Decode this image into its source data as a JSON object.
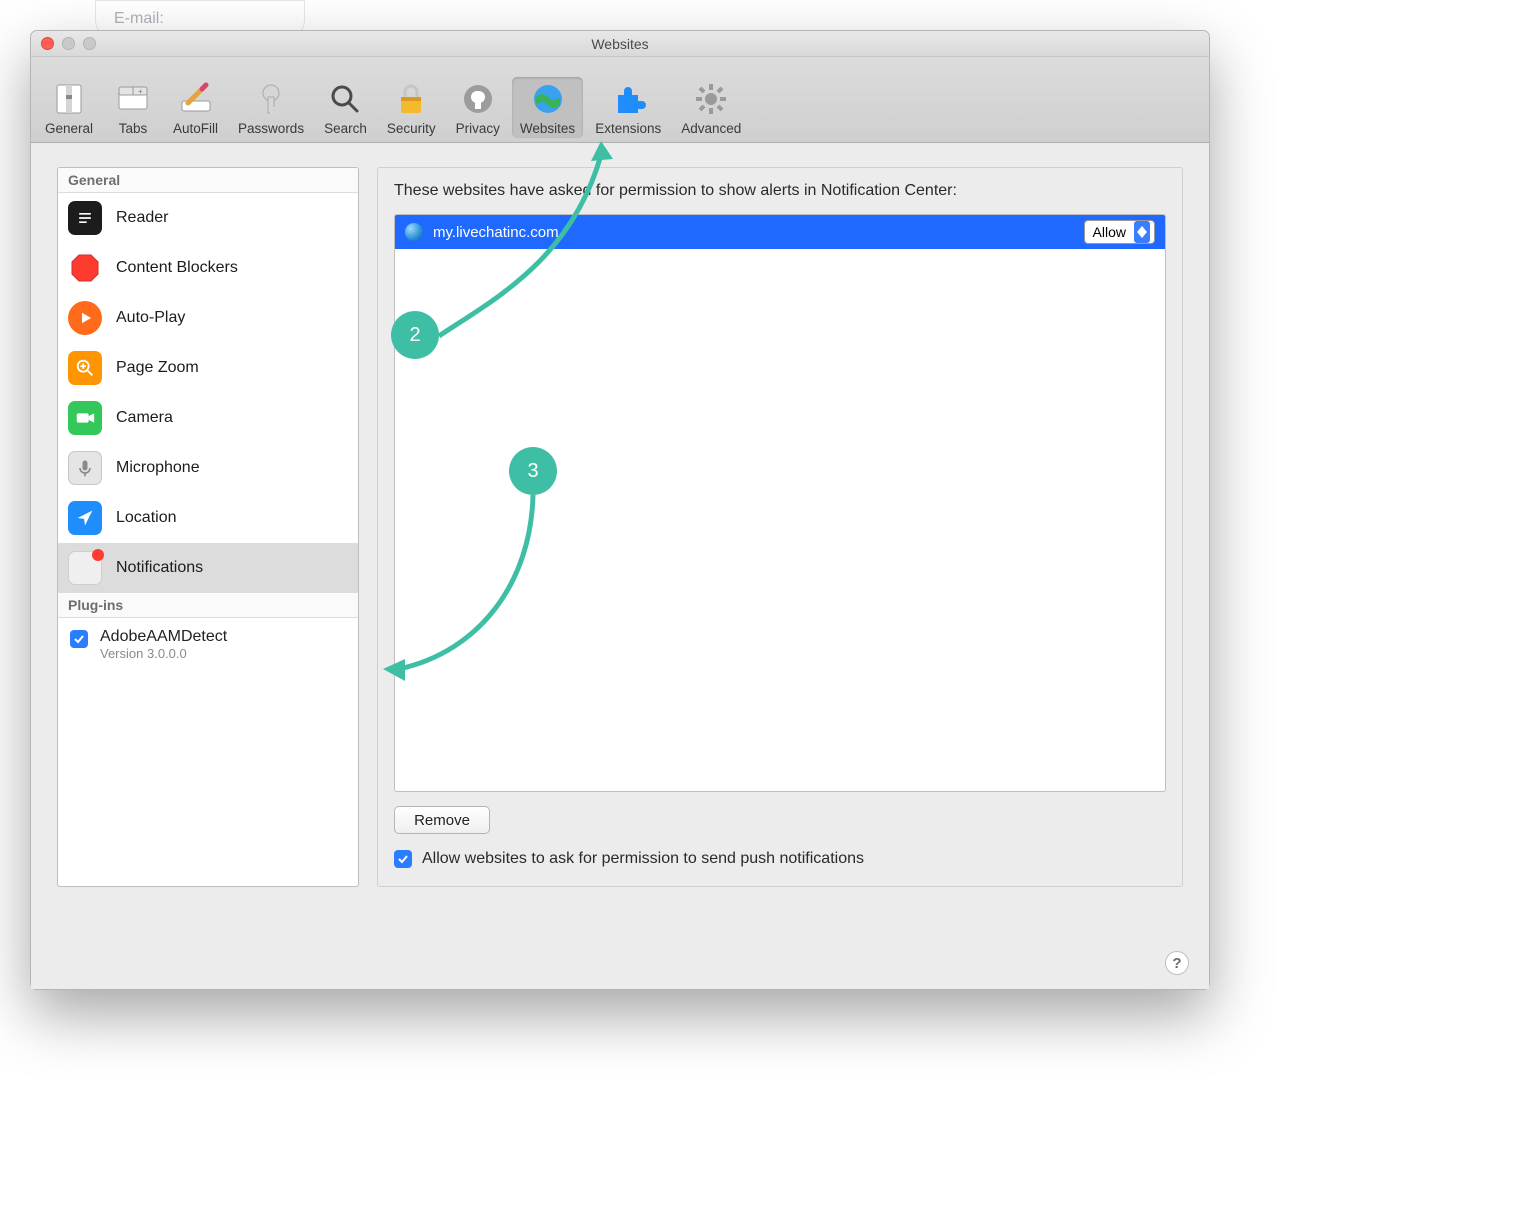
{
  "hint_bubble": "E-mail:",
  "window_title": "Websites",
  "toolbar": [
    {
      "id": "general",
      "label": "General"
    },
    {
      "id": "tabs",
      "label": "Tabs"
    },
    {
      "id": "autofill",
      "label": "AutoFill"
    },
    {
      "id": "passwords",
      "label": "Passwords"
    },
    {
      "id": "search",
      "label": "Search"
    },
    {
      "id": "security",
      "label": "Security"
    },
    {
      "id": "privacy",
      "label": "Privacy"
    },
    {
      "id": "websites",
      "label": "Websites",
      "selected": true
    },
    {
      "id": "extensions",
      "label": "Extensions"
    },
    {
      "id": "advanced",
      "label": "Advanced"
    }
  ],
  "sidebar": {
    "section1_title": "General",
    "items": [
      {
        "id": "reader",
        "label": "Reader"
      },
      {
        "id": "blockers",
        "label": "Content Blockers"
      },
      {
        "id": "autoplay",
        "label": "Auto-Play"
      },
      {
        "id": "zoom",
        "label": "Page Zoom"
      },
      {
        "id": "camera",
        "label": "Camera"
      },
      {
        "id": "microphone",
        "label": "Microphone"
      },
      {
        "id": "location",
        "label": "Location"
      },
      {
        "id": "notifications",
        "label": "Notifications",
        "selected": true
      }
    ],
    "section2_title": "Plug-ins",
    "plugin": {
      "name": "AdobeAAMDetect",
      "version": "Version 3.0.0.0",
      "enabled": true
    }
  },
  "main": {
    "prompt": "These websites have asked for permission to show alerts in Notification Center:",
    "sites": [
      {
        "domain": "my.livechatinc.com",
        "permission": "Allow"
      }
    ],
    "remove_label": "Remove",
    "footer_checkbox_label": "Allow websites to ask for permission to send push notifications",
    "footer_checkbox_checked": true
  },
  "callouts": {
    "step2": "2",
    "step3": "3"
  },
  "help": "?"
}
